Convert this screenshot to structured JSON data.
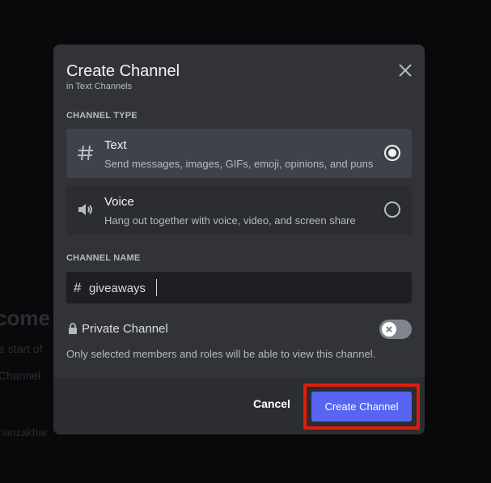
{
  "background": {
    "welcome_fragment": "come",
    "start_fragment": "e start of",
    "channel_fragment": "Channel",
    "user_fragment": "rianzakhar"
  },
  "modal": {
    "title": "Create Channel",
    "subtitle": "in Text Channels",
    "close_icon": "close-x-icon"
  },
  "channel_type": {
    "label": "CHANNEL TYPE",
    "options": [
      {
        "icon": "hash-icon",
        "title": "Text",
        "description": "Send messages, images, GIFs, emoji, opinions, and puns",
        "selected": true
      },
      {
        "icon": "speaker-icon",
        "title": "Voice",
        "description": "Hang out together with voice, video, and screen share",
        "selected": false
      }
    ]
  },
  "channel_name": {
    "label": "CHANNEL NAME",
    "prefix": "#",
    "value": "giveaways"
  },
  "private_channel": {
    "label": "Private Channel",
    "icon": "lock-icon",
    "enabled": false,
    "description": "Only selected members and roles will be able to view this channel."
  },
  "footer": {
    "cancel_label": "Cancel",
    "create_label": "Create Channel"
  },
  "colors": {
    "accent": "#5865f2",
    "highlight": "#e21c0b",
    "modal_bg": "#313338",
    "footer_bg": "#2b2d31"
  }
}
